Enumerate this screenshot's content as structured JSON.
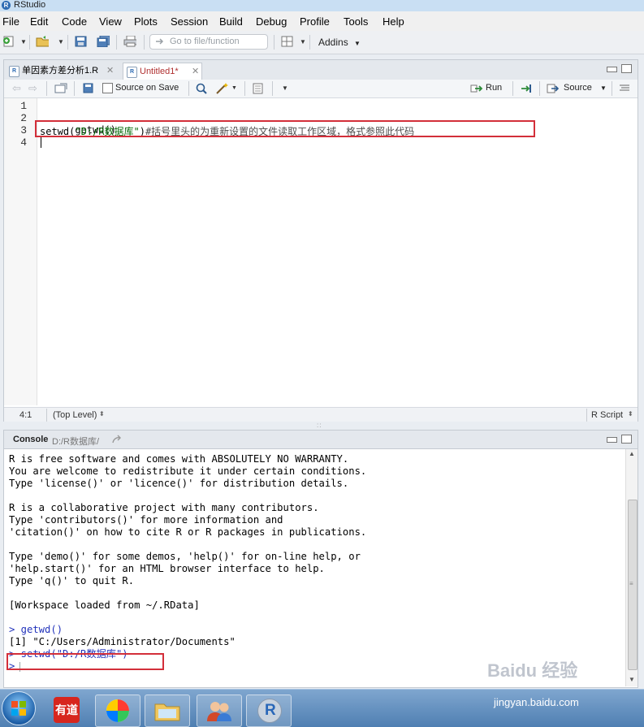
{
  "window": {
    "title": "RStudio"
  },
  "menubar": {
    "items": [
      "File",
      "Edit",
      "Code",
      "View",
      "Plots",
      "Session",
      "Build",
      "Debug",
      "Profile",
      "Tools",
      "Help"
    ]
  },
  "toolbar": {
    "goto_placeholder": "Go to file/function",
    "addins_label": "Addins"
  },
  "editor": {
    "tabs": [
      {
        "label": "单因素方差分析1.R"
      },
      {
        "label": "Untitled1*"
      }
    ],
    "toolbar": {
      "source_on_save": "Source on Save",
      "run_label": "Run",
      "source_label": "Source"
    },
    "line_numbers": [
      "1",
      "2",
      "3",
      "4"
    ],
    "lines": {
      "l2": "getwd()",
      "l3_fn": "setwd(",
      "l3_str": "\"D:/R数据库\"",
      "l3_close": ")",
      "l3_comment": "#括号里头的为重新设置的文件读取工作区域，格式参照此代码"
    },
    "status": {
      "position": "4:1",
      "scope": "(Top Level)",
      "file_type": "R Script"
    }
  },
  "console": {
    "title": "Console",
    "path": "D:/R数据库/",
    "lines": [
      "R is free software and comes with ABSOLUTELY NO WARRANTY.",
      "You are welcome to redistribute it under certain conditions.",
      "Type 'license()' or 'licence()' for distribution details.",
      "",
      "R is a collaborative project with many contributors.",
      "Type 'contributors()' for more information and",
      "'citation()' on how to cite R or R packages in publications.",
      "",
      "Type 'demo()' for some demos, 'help()' for on-line help, or",
      "'help.start()' for an HTML browser interface to help.",
      "Type 'q()' to quit R.",
      "",
      "[Workspace loaded from ~/.RData]",
      ""
    ],
    "cmd1": "> getwd()",
    "out1": "[1] \"C:/Users/Administrator/Documents\"",
    "cmd2": "> setwd(\"D:/R数据库\")",
    "prompt": ">"
  },
  "taskbar": {
    "youdao_label": "有道",
    "r_label": "R"
  },
  "watermark": {
    "text": "Baidu 经验",
    "url": "jingyan.baidu.com"
  },
  "colors": {
    "highlight_box": "#d32f3a",
    "command_blue": "#2233bb",
    "string_green": "#036a07"
  }
}
